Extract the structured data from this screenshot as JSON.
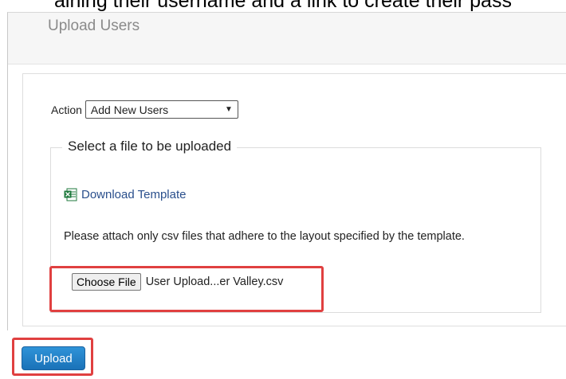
{
  "document": {
    "clipped_text": "aining their username and a link to create their pass"
  },
  "panel": {
    "title": "Upload Users"
  },
  "action": {
    "label": "Action",
    "selected": "Add New Users"
  },
  "file_section": {
    "legend": "Select a file to be uploaded",
    "download_link": "Download Template",
    "help_text": "Please attach only csv files that adhere to the layout specified by the template.",
    "choose_button": "Choose File",
    "file_name": "User Upload...er Valley.csv"
  },
  "footer": {
    "upload_button": "Upload"
  },
  "colors": {
    "accent": "#1a72b8",
    "link": "#2a4f8c",
    "highlight": "#e04040",
    "excel_green": "#1f7a3e"
  },
  "icons": {
    "template": "excel-file-icon",
    "select": "chevron-down-icon"
  }
}
